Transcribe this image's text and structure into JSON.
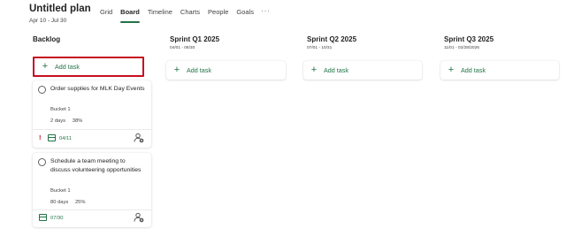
{
  "plan": {
    "title": "Untitled plan",
    "dates": "Apr 10 - Jul 30"
  },
  "views": [
    {
      "label": "Grid",
      "active": false
    },
    {
      "label": "Board",
      "active": true
    },
    {
      "label": "Timeline",
      "active": false
    },
    {
      "label": "Charts",
      "active": false
    },
    {
      "label": "People",
      "active": false
    },
    {
      "label": "Goals",
      "active": false
    }
  ],
  "more_views_label": "···",
  "accent_color": "#217346",
  "highlight_color": "#c50f1f",
  "buckets": [
    {
      "name": "Backlog",
      "dates": "",
      "add_label": "Add task"
    },
    {
      "name": "Sprint Q1 2025",
      "dates": "04/01 - 06/30",
      "add_label": "Add task"
    },
    {
      "name": "Sprint Q2 2025",
      "dates": "07/01 - 10/31",
      "add_label": "Add task"
    },
    {
      "name": "Sprint Q3 2025",
      "dates": "11/01 - 02/28/2026",
      "add_label": "Add task"
    }
  ],
  "tasks": [
    {
      "title": "Order supplies for MLK Day Events",
      "bucket": "Bucket 1",
      "duration": "2 days",
      "progress": "38%",
      "priority": "!",
      "due": "04/11"
    },
    {
      "title": "Schedule a team meeting to discuss volunteering opportunities",
      "bucket": "Bucket 1",
      "duration": "80 days",
      "progress": "25%",
      "due": "07/30"
    }
  ]
}
